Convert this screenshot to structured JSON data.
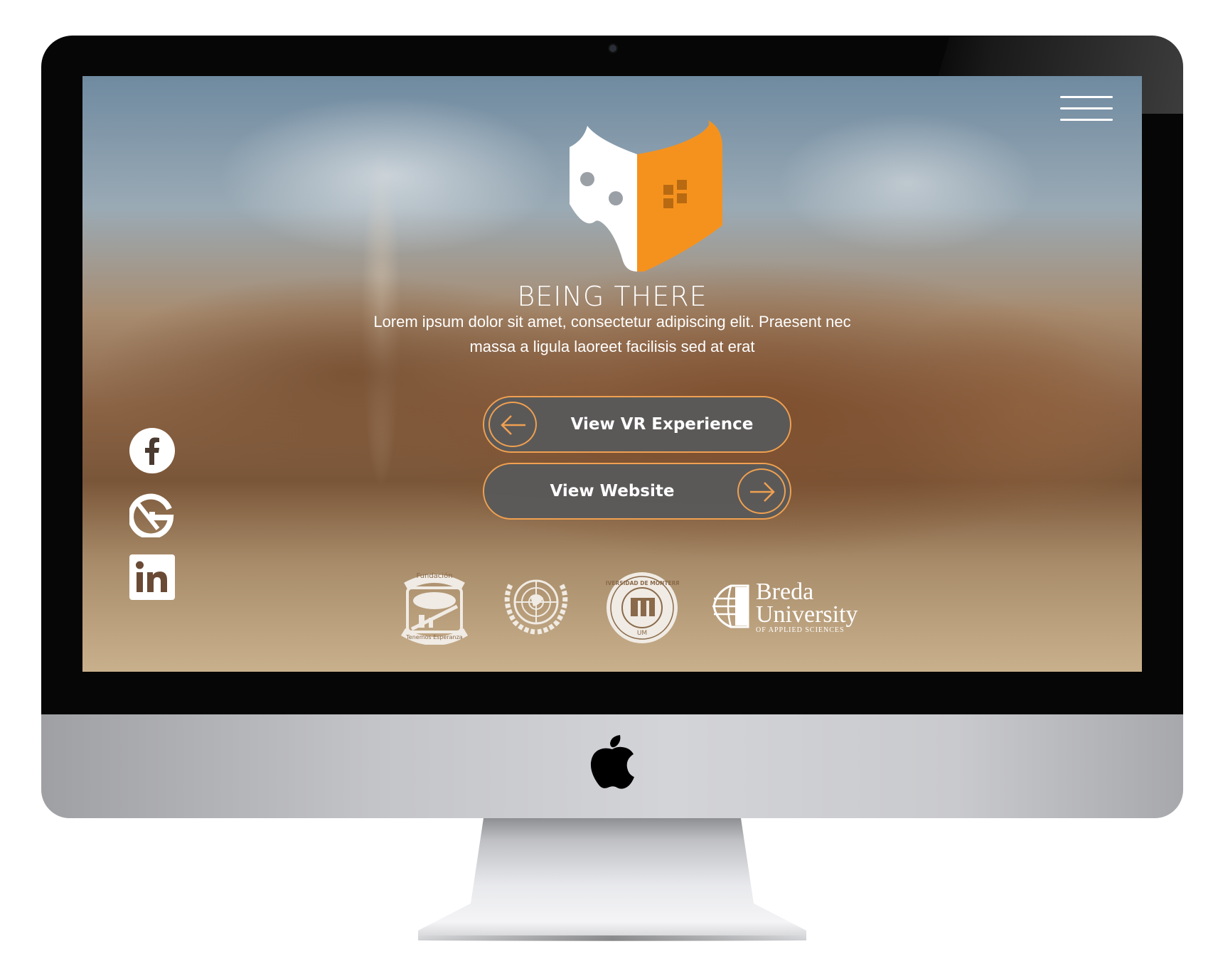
{
  "device": {
    "frame": "iMac",
    "colors": {
      "bezel": "#060606",
      "chin": "#c4c5c9",
      "stand": "#e8e9ec"
    }
  },
  "site": {
    "brand": {
      "title": "BEING THERE",
      "logo_icon": "vr-headset-house-logo",
      "colors": {
        "primary": "#f5921e",
        "secondary": "#ffffff"
      }
    },
    "tagline_line1": "Lorem ipsum dolor sit amet, consectetur adipiscing elit. Praesent nec",
    "tagline_line2": "massa a ligula laoreet facilisis sed at erat",
    "menu_icon": "hamburger-menu-icon",
    "buttons": {
      "vr": {
        "label": "View VR Experience",
        "icon": "arrow-left-icon"
      },
      "website": {
        "label": "View Website",
        "icon": "arrow-right-icon"
      },
      "accent": "#f0a050",
      "background": "#5a5a5a"
    },
    "social": [
      {
        "name": "facebook",
        "icon": "facebook-icon"
      },
      {
        "name": "google",
        "icon": "google-icon"
      },
      {
        "name": "linkedin",
        "icon": "linkedin-icon"
      }
    ],
    "partners": [
      {
        "icon": "fundacion-seal-logo",
        "text_top": "Fundación",
        "text_bottom": "Tenemos Esperanza"
      },
      {
        "icon": "united-nations-emblem"
      },
      {
        "icon": "universidad-de-monterrey-seal",
        "text_top": "UNIVERSIDAD DE MONTERREY",
        "monogram": "UM"
      },
      {
        "icon": "breda-university-logo",
        "line1": "Breda",
        "line2": "University",
        "line3": "OF APPLIED SCIENCES"
      }
    ]
  }
}
